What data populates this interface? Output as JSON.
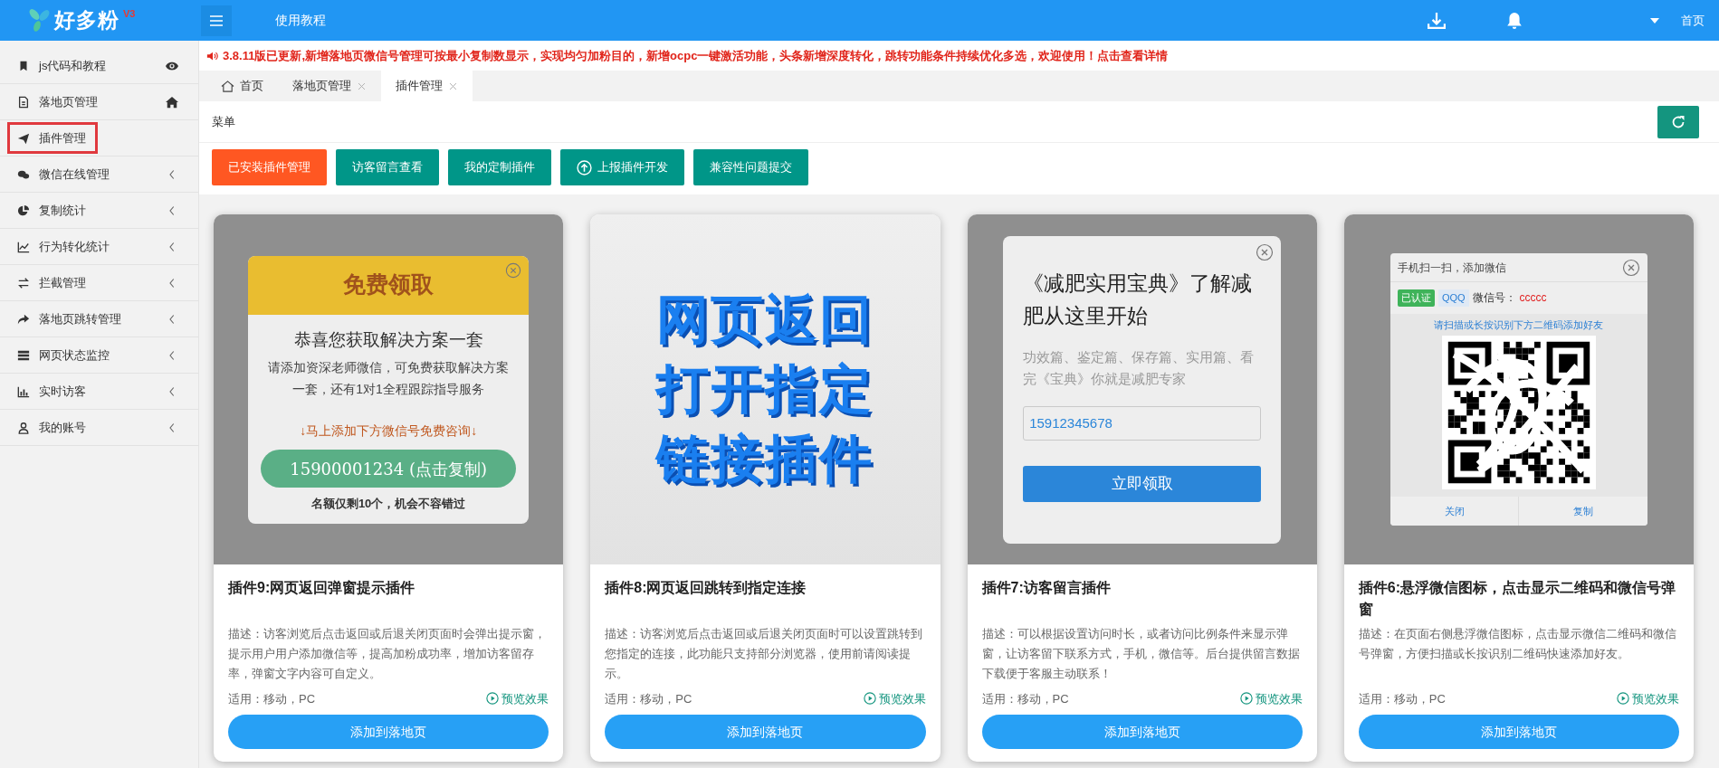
{
  "header": {
    "logo": "好多粉",
    "logo_badge": "V3",
    "tutorial_link": "使用教程",
    "home_link": "首页"
  },
  "sidebar": {
    "items": [
      {
        "label": "js代码和教程",
        "selected": false,
        "expandable": false
      },
      {
        "label": "落地页管理",
        "selected": false,
        "expandable": false
      },
      {
        "label": "插件管理",
        "selected": true,
        "expandable": false
      },
      {
        "label": "微信在线管理",
        "selected": false,
        "expandable": true
      },
      {
        "label": "复制统计",
        "selected": false,
        "expandable": true
      },
      {
        "label": "行为转化统计",
        "selected": false,
        "expandable": true
      },
      {
        "label": "拦截管理",
        "selected": false,
        "expandable": true
      },
      {
        "label": "落地页跳转管理",
        "selected": false,
        "expandable": true
      },
      {
        "label": "网页状态监控",
        "selected": false,
        "expandable": true
      },
      {
        "label": "实时访客",
        "selected": false,
        "expandable": true
      },
      {
        "label": "我的账号",
        "selected": false,
        "expandable": true
      }
    ]
  },
  "notice": "3.8.11版已更新,新增落地页微信号管理可按最小复制数显示，实现均匀加粉目的，新增ocpc一键激活功能，头条新增深度转化，跳转功能条件持续优化多选，欢迎使用！点击查看详情",
  "tabs": [
    {
      "label": "首页",
      "selected": false,
      "closable": false
    },
    {
      "label": "落地页管理",
      "selected": false,
      "closable": true
    },
    {
      "label": "插件管理",
      "selected": true,
      "closable": true
    }
  ],
  "panel_title": "菜单",
  "toolbar": [
    {
      "label": "已安装插件管理",
      "selected": true
    },
    {
      "label": "访客留言查看",
      "selected": false
    },
    {
      "label": "我的定制插件",
      "selected": false
    },
    {
      "label": "上报插件开发",
      "selected": false
    },
    {
      "label": "兼容性问题提交",
      "selected": false
    }
  ],
  "plugins": [
    {
      "title": "插件9:网页返回弹窗提示插件",
      "description": "描述：访客浏览后点击返回或后退关闭页面时会弹出提示窗，提示用户用户添加微信等，提高加粉成功率，增加访客留存率，弹窗文字内容可自定义。",
      "platforms": "适用：移动，PC",
      "preview_link": "预览效果",
      "add_button": "添加到落地页",
      "preview": {
        "kind": "offer",
        "header": "免费领取",
        "heading": "恭喜您获取解决方案一套",
        "body": "请添加资深老师微信，可免费获取解决方案一套，还有1对1全程跟踪指导服务",
        "hint": "↓马上添加下方微信号免费咨询↓",
        "button": "15900001234 (点击复制)",
        "footnote": "名额仅剩10个，机会不容错过"
      }
    },
    {
      "title": "插件8:网页返回跳转到指定连接",
      "description": "描述：访客浏览后点击返回或后退关闭页面时可以设置跳转到您指定的连接，此功能只支持部分浏览器，使用前请阅读提示。",
      "platforms": "适用：移动，PC",
      "preview_link": "预览效果",
      "add_button": "添加到落地页",
      "preview": {
        "kind": "banner",
        "lines": [
          "网页返回",
          "打开指定",
          "链接插件"
        ]
      }
    },
    {
      "title": "插件7:访客留言插件",
      "description": "描述：可以根据设置访问时长，或者访问比例条件来显示弹窗，让访客留下联系方式，手机，微信等。后台提供留言数据下载便于客服主动联系！",
      "platforms": "适用：移动，PC",
      "preview_link": "预览效果",
      "add_button": "添加到落地页",
      "preview": {
        "kind": "form",
        "heading": "《减肥实用宝典》了解减肥从这里开始",
        "body": "功效篇、鉴定篇、保存篇、实用篇、看完《宝典》你就是减肥专家",
        "value": "15912345678",
        "button": "立即领取"
      }
    },
    {
      "title": "插件6:悬浮微信图标，点击显示二维码和微信号弹窗",
      "description": "描述：在页面右侧悬浮微信图标，点击显示微信二维码和微信号弹窗，方便扫描或长按识别二维码快速添加好友。",
      "platforms": "适用：移动，PC",
      "preview_link": "预览效果",
      "add_button": "添加到落地页",
      "preview": {
        "kind": "qr",
        "title": "手机扫一扫，添加微信",
        "verified": "已认证",
        "account_type": "QQQ",
        "wechat_label": "微信号：",
        "wechat_id": "ccccc",
        "hint": "请扫描或长按识别下方二维码添加好友",
        "buttons": [
          "关闭",
          "复制"
        ]
      }
    }
  ]
}
